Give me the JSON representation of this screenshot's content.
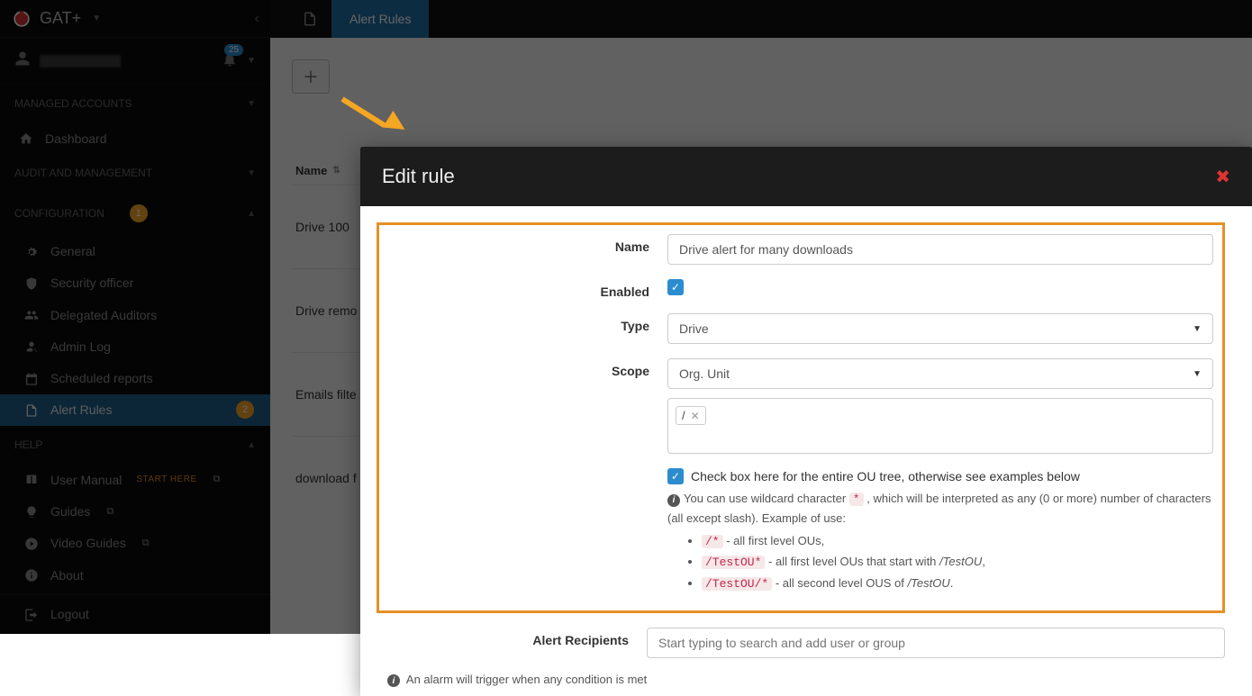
{
  "brand": {
    "name": "GAT+"
  },
  "notifications": {
    "count": "25"
  },
  "sections": {
    "managed": "MANAGED ACCOUNTS",
    "audit": "AUDIT AND MANAGEMENT",
    "config": "CONFIGURATION",
    "help": "HELP"
  },
  "nav": {
    "dashboard": "Dashboard",
    "general": "General",
    "security_officer": "Security officer",
    "delegated_auditors": "Delegated Auditors",
    "admin_log": "Admin Log",
    "scheduled_reports": "Scheduled reports",
    "alert_rules": "Alert Rules",
    "user_manual": "User Manual",
    "start_here": "START HERE",
    "guides": "Guides",
    "video_guides": "Video Guides",
    "about": "About",
    "logout": "Logout"
  },
  "badges": {
    "config": "1",
    "alert_rules": "2"
  },
  "topbar": {
    "tab": "Alert Rules"
  },
  "table": {
    "name_col": "Name",
    "rows": [
      "Drive 100",
      "Drive remo",
      "Emails filte",
      "download f"
    ]
  },
  "modal": {
    "title": "Edit rule",
    "labels": {
      "name": "Name",
      "enabled": "Enabled",
      "type": "Type",
      "scope": "Scope",
      "alert_recipients": "Alert Recipients"
    },
    "values": {
      "name": "Drive alert for many downloads",
      "type": "Drive",
      "scope": "Org. Unit",
      "scope_tag": "/"
    },
    "placeholders": {
      "recipients": "Start typing to search and add user or group"
    },
    "check_ou": "Check box here for the entire OU tree, otherwise see examples below",
    "hint_lead": "You can use wildcard character ",
    "hint_star": "*",
    "hint_tail": " , which will be interpreted as any (0 or more) number of characters (all except slash). Example of use:",
    "ex1_code": "/*",
    "ex1_txt": " - all first level OUs,",
    "ex2_code": "/TestOU*",
    "ex2_txt": " - all first level OUs that start with ",
    "ex2_em": "/TestOU",
    "ex3_code": "/TestOU/*",
    "ex3_txt": " - all second level OUS of ",
    "ex3_em": "/TestOU",
    "alarm_note": "An alarm will trigger when any condition is met"
  }
}
